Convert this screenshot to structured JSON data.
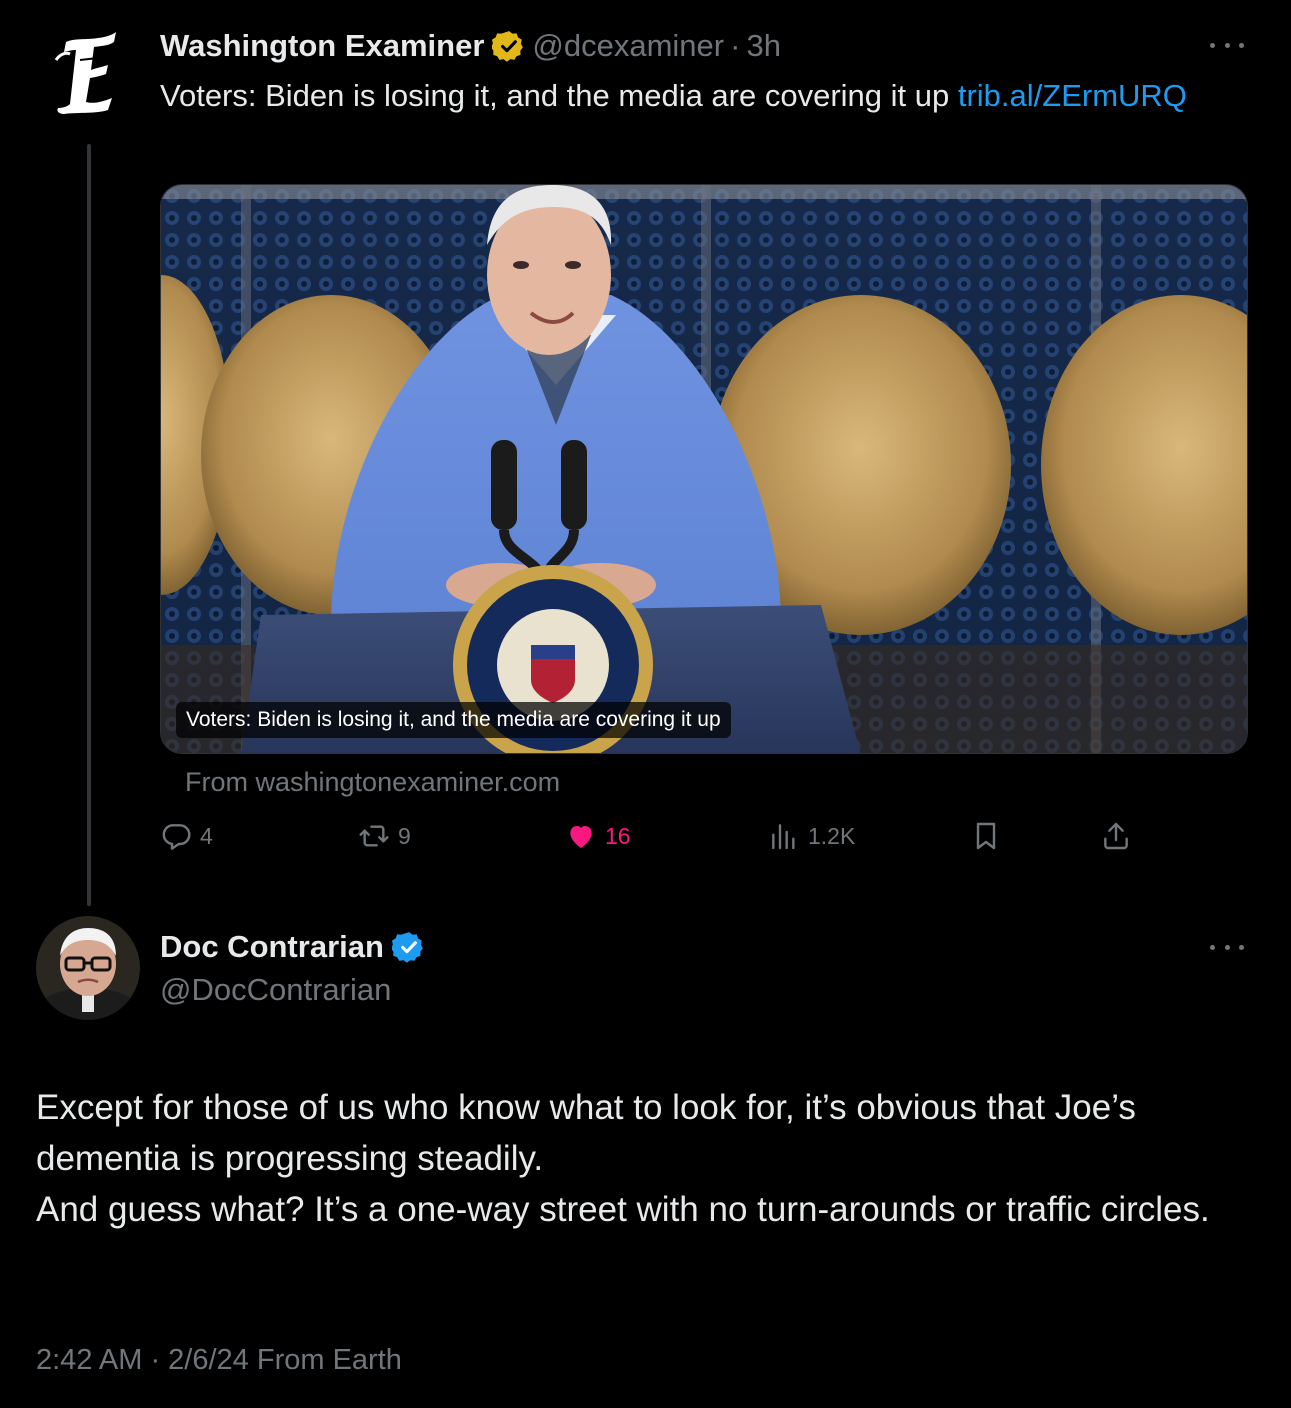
{
  "theme": {
    "background": "#000000",
    "text_primary": "#e7e9ea",
    "text_secondary": "#71767b",
    "link": "#1d9bf0",
    "like": "#f91880",
    "gold_badge": "#e2b719",
    "blue_badge": "#1d9bf0"
  },
  "tweet1": {
    "avatar_icon": "washington-examiner-logo-icon",
    "author_name": "Washington Examiner",
    "verified_badge": "gold-verified-badge-icon",
    "handle": "@dcexaminer",
    "separator": "·",
    "time": "3h",
    "text": "Voters: Biden is losing it, and the media are covering it up ",
    "link_text": "trib.al/ZErmURQ",
    "card": {
      "caption": "Voters: Biden is losing it, and the media are covering it up",
      "source": "From washingtonexaminer.com"
    },
    "actions": {
      "replies": "4",
      "reposts": "9",
      "likes": "16",
      "views": "1.2K"
    }
  },
  "tweet2": {
    "author_name": "Doc Contrarian",
    "verified_badge": "blue-verified-badge-icon",
    "handle": "@DocContrarian",
    "text_line1": "Except for those of us who know what to look for, it’s obvious that Joe’s dementia is progressing steadily.",
    "text_line2": "And guess what? It’s a one-way street with no turn-arounds or traffic circles.",
    "meta": "2:42 AM · 2/6/24 From Earth"
  }
}
